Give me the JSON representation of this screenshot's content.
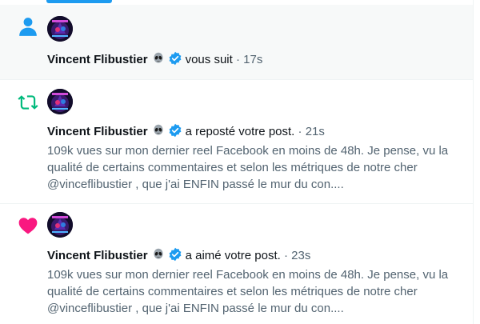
{
  "notifications": [
    {
      "type": "follow",
      "icon": "person-icon",
      "name": "Vincent Flibustier",
      "action": "vous suit",
      "sep": "·",
      "time": "17s"
    },
    {
      "type": "repost",
      "icon": "repost-icon",
      "name": "Vincent Flibustier",
      "action": "a reposté votre post.",
      "sep": "·",
      "time": "21s",
      "text": "109k vues sur mon dernier reel Facebook en moins de 48h. Je pense, vu la qualité de certains commentaires et selon les métriques de notre cher @vinceflibustier , que j'ai ENFIN passé le mur du con...."
    },
    {
      "type": "like",
      "icon": "heart-icon",
      "name": "Vincent Flibustier",
      "action": "a aimé votre post.",
      "sep": "·",
      "time": "23s",
      "text": "109k vues sur mon dernier reel Facebook en moins de 48h. Je pense, vu la qualité de certains commentaires et selon les métriques de notre cher @vinceflibustier , que j'ai ENFIN passé le mur du con...."
    }
  ],
  "colors": {
    "accent": "#1d9bf0",
    "repost": "#00ba7c",
    "like": "#f91880",
    "secondary_text": "#536471"
  }
}
